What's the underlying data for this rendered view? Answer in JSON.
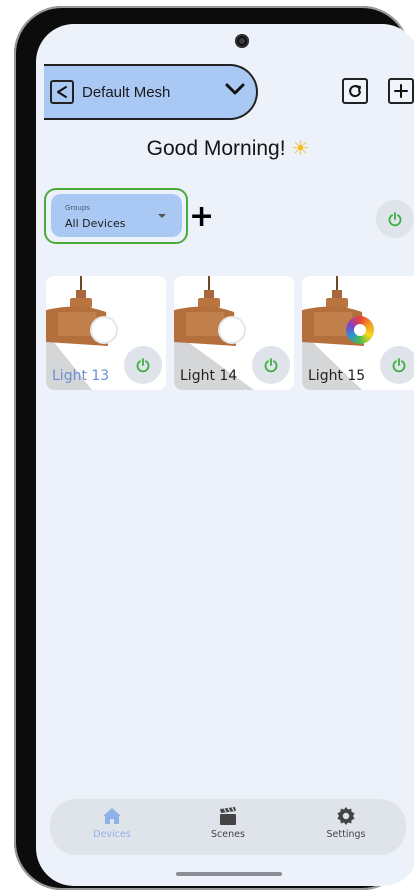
{
  "header": {
    "mesh_name": "Default Mesh",
    "greeting": "Good Morning!",
    "greeting_icon": "sun-icon"
  },
  "groups": {
    "caption": "Groups",
    "selected": "All Devices"
  },
  "devices": [
    {
      "label": "Light 13",
      "bulb": "white",
      "active": true
    },
    {
      "label": "Light 14",
      "bulb": "white",
      "active": false
    },
    {
      "label": "Light 15",
      "bulb": "rgb",
      "active": false
    }
  ],
  "nav": {
    "items": [
      {
        "label": "Devices",
        "icon": "home-icon",
        "active": true
      },
      {
        "label": "Scenes",
        "icon": "clapperboard-icon",
        "active": false
      },
      {
        "label": "Settings",
        "icon": "gear-icon",
        "active": false
      }
    ]
  },
  "colors": {
    "accent_blue": "#a9c8f3",
    "power_green": "#3cae3c",
    "highlight_green": "#4aab3d",
    "background": "#edf1fa"
  }
}
